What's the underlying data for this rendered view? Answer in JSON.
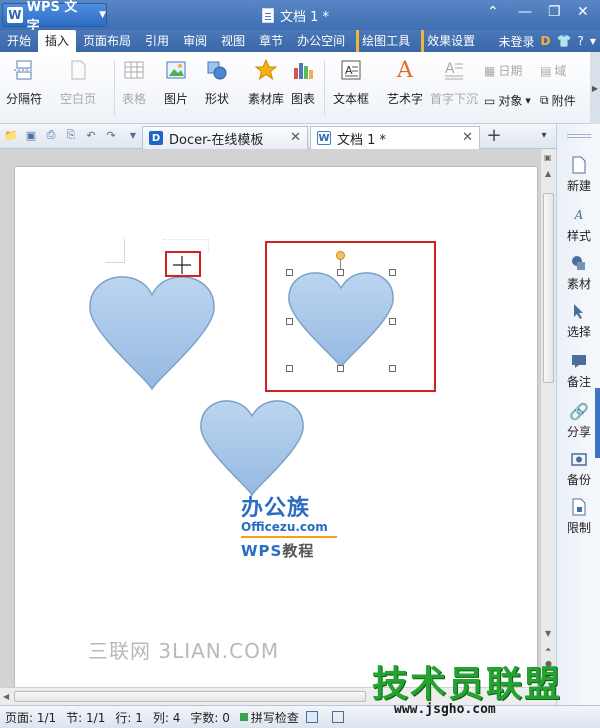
{
  "app": {
    "name": "WPS 文字",
    "logo_letter": "W",
    "document_title": "文档 1 *"
  },
  "window_controls": {
    "collapse": "⌃",
    "minimize": "—",
    "restore": "❐",
    "close": "✕"
  },
  "menu": {
    "items": [
      "开始",
      "插入",
      "页面布局",
      "引用",
      "审阅",
      "视图",
      "章节",
      "办公空间"
    ],
    "active_index": 1,
    "context_tabs": [
      "绘图工具",
      "效果设置"
    ],
    "login": "未登录",
    "accent_color": "#f2b33d"
  },
  "ribbon": {
    "page_break": "分隔符",
    "blank_page": "空白页",
    "table": "表格",
    "picture": "图片",
    "shape": "形状",
    "material_library": "素材库",
    "chart": "图表",
    "text_box": "文本框",
    "word_art": "艺术字",
    "drop_cap": "首字下沉",
    "date": "日期",
    "field": "域",
    "object": "对象",
    "attachment": "附件"
  },
  "tabs": [
    {
      "label": "Docer-在线模板",
      "icon": "docer-icon",
      "active": false
    },
    {
      "label": "文档 1 *",
      "icon": "document-icon",
      "active": true
    }
  ],
  "sidebar": {
    "items": [
      "新建",
      "样式",
      "素材",
      "选择",
      "备注",
      "分享",
      "备份",
      "限制"
    ],
    "accent_color": "#3d74c2"
  },
  "status": {
    "page": "页面: 1/1",
    "section": "节: 1/1",
    "line": "行: 1",
    "column": "列: 4",
    "word_count": "字数: 0",
    "spell_check": "拼写检查"
  },
  "canvas": {
    "heart_color": "#a9c8ea",
    "heart_stroke": "#7da1c8",
    "highlight_color": "#d42020"
  },
  "watermarks": {
    "sanlian": "三联网 3LIAN.COM",
    "officezu_top": "办公族",
    "officezu_url": "Officezu.com",
    "wps_tutorial_prefix": "WPS",
    "wps_tutorial_suffix": "教程",
    "jsgho_big": "技术员联盟",
    "jsgho_url": "www.jsgho.com"
  }
}
